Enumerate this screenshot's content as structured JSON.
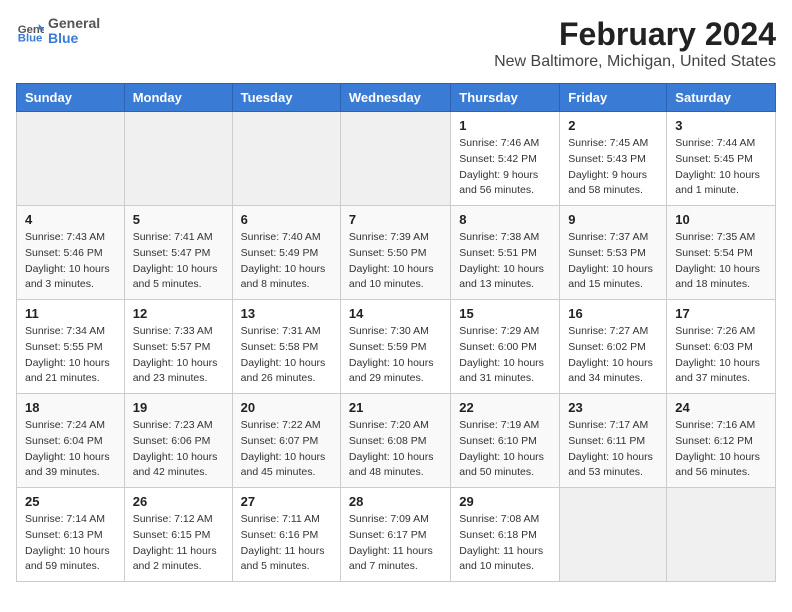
{
  "header": {
    "logo": {
      "line1": "General",
      "line2": "Blue"
    },
    "title": "February 2024",
    "subtitle": "New Baltimore, Michigan, United States"
  },
  "days_of_week": [
    "Sunday",
    "Monday",
    "Tuesday",
    "Wednesday",
    "Thursday",
    "Friday",
    "Saturday"
  ],
  "weeks": [
    [
      {
        "day": "",
        "info": ""
      },
      {
        "day": "",
        "info": ""
      },
      {
        "day": "",
        "info": ""
      },
      {
        "day": "",
        "info": ""
      },
      {
        "day": "1",
        "info": "Sunrise: 7:46 AM\nSunset: 5:42 PM\nDaylight: 9 hours and 56 minutes."
      },
      {
        "day": "2",
        "info": "Sunrise: 7:45 AM\nSunset: 5:43 PM\nDaylight: 9 hours and 58 minutes."
      },
      {
        "day": "3",
        "info": "Sunrise: 7:44 AM\nSunset: 5:45 PM\nDaylight: 10 hours and 1 minute."
      }
    ],
    [
      {
        "day": "4",
        "info": "Sunrise: 7:43 AM\nSunset: 5:46 PM\nDaylight: 10 hours and 3 minutes."
      },
      {
        "day": "5",
        "info": "Sunrise: 7:41 AM\nSunset: 5:47 PM\nDaylight: 10 hours and 5 minutes."
      },
      {
        "day": "6",
        "info": "Sunrise: 7:40 AM\nSunset: 5:49 PM\nDaylight: 10 hours and 8 minutes."
      },
      {
        "day": "7",
        "info": "Sunrise: 7:39 AM\nSunset: 5:50 PM\nDaylight: 10 hours and 10 minutes."
      },
      {
        "day": "8",
        "info": "Sunrise: 7:38 AM\nSunset: 5:51 PM\nDaylight: 10 hours and 13 minutes."
      },
      {
        "day": "9",
        "info": "Sunrise: 7:37 AM\nSunset: 5:53 PM\nDaylight: 10 hours and 15 minutes."
      },
      {
        "day": "10",
        "info": "Sunrise: 7:35 AM\nSunset: 5:54 PM\nDaylight: 10 hours and 18 minutes."
      }
    ],
    [
      {
        "day": "11",
        "info": "Sunrise: 7:34 AM\nSunset: 5:55 PM\nDaylight: 10 hours and 21 minutes."
      },
      {
        "day": "12",
        "info": "Sunrise: 7:33 AM\nSunset: 5:57 PM\nDaylight: 10 hours and 23 minutes."
      },
      {
        "day": "13",
        "info": "Sunrise: 7:31 AM\nSunset: 5:58 PM\nDaylight: 10 hours and 26 minutes."
      },
      {
        "day": "14",
        "info": "Sunrise: 7:30 AM\nSunset: 5:59 PM\nDaylight: 10 hours and 29 minutes."
      },
      {
        "day": "15",
        "info": "Sunrise: 7:29 AM\nSunset: 6:00 PM\nDaylight: 10 hours and 31 minutes."
      },
      {
        "day": "16",
        "info": "Sunrise: 7:27 AM\nSunset: 6:02 PM\nDaylight: 10 hours and 34 minutes."
      },
      {
        "day": "17",
        "info": "Sunrise: 7:26 AM\nSunset: 6:03 PM\nDaylight: 10 hours and 37 minutes."
      }
    ],
    [
      {
        "day": "18",
        "info": "Sunrise: 7:24 AM\nSunset: 6:04 PM\nDaylight: 10 hours and 39 minutes."
      },
      {
        "day": "19",
        "info": "Sunrise: 7:23 AM\nSunset: 6:06 PM\nDaylight: 10 hours and 42 minutes."
      },
      {
        "day": "20",
        "info": "Sunrise: 7:22 AM\nSunset: 6:07 PM\nDaylight: 10 hours and 45 minutes."
      },
      {
        "day": "21",
        "info": "Sunrise: 7:20 AM\nSunset: 6:08 PM\nDaylight: 10 hours and 48 minutes."
      },
      {
        "day": "22",
        "info": "Sunrise: 7:19 AM\nSunset: 6:10 PM\nDaylight: 10 hours and 50 minutes."
      },
      {
        "day": "23",
        "info": "Sunrise: 7:17 AM\nSunset: 6:11 PM\nDaylight: 10 hours and 53 minutes."
      },
      {
        "day": "24",
        "info": "Sunrise: 7:16 AM\nSunset: 6:12 PM\nDaylight: 10 hours and 56 minutes."
      }
    ],
    [
      {
        "day": "25",
        "info": "Sunrise: 7:14 AM\nSunset: 6:13 PM\nDaylight: 10 hours and 59 minutes."
      },
      {
        "day": "26",
        "info": "Sunrise: 7:12 AM\nSunset: 6:15 PM\nDaylight: 11 hours and 2 minutes."
      },
      {
        "day": "27",
        "info": "Sunrise: 7:11 AM\nSunset: 6:16 PM\nDaylight: 11 hours and 5 minutes."
      },
      {
        "day": "28",
        "info": "Sunrise: 7:09 AM\nSunset: 6:17 PM\nDaylight: 11 hours and 7 minutes."
      },
      {
        "day": "29",
        "info": "Sunrise: 7:08 AM\nSunset: 6:18 PM\nDaylight: 11 hours and 10 minutes."
      },
      {
        "day": "",
        "info": ""
      },
      {
        "day": "",
        "info": ""
      }
    ]
  ]
}
